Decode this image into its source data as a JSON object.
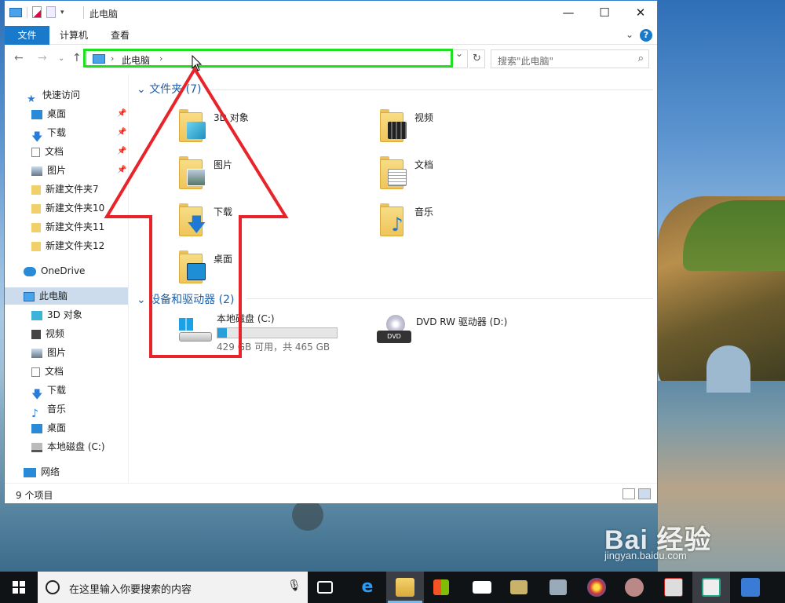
{
  "window": {
    "title": "此电脑",
    "controls": {
      "minimize": "—",
      "maximize": "☐",
      "close": "✕"
    }
  },
  "ribbon": {
    "tabs": [
      "文件",
      "计算机",
      "查看"
    ]
  },
  "address": {
    "crumbs": [
      "此电脑"
    ],
    "search_placeholder": "搜索\"此电脑\""
  },
  "sidebar": {
    "quick_access": "快速访问",
    "quick_items": [
      "桌面",
      "下载",
      "文档",
      "图片",
      "新建文件夹7",
      "新建文件夹10",
      "新建文件夹11",
      "新建文件夹12"
    ],
    "onedrive": "OneDrive",
    "this_pc": "此电脑",
    "pc_items": [
      "3D 对象",
      "视频",
      "图片",
      "文档",
      "下载",
      "音乐",
      "桌面",
      "本地磁盘 (C:)"
    ],
    "network": "网络"
  },
  "main": {
    "folders_header": "文件夹 (7)",
    "folders": [
      "3D 对象",
      "视频",
      "图片",
      "文档",
      "下载",
      "音乐",
      "桌面"
    ],
    "devices_header": "设备和驱动器 (2)",
    "drives": [
      {
        "name": "本地磁盘 (C:)",
        "space": "429 GB 可用，共 465 GB",
        "used_fraction": 0.08
      },
      {
        "name": "DVD RW 驱动器 (D:)"
      }
    ]
  },
  "status": {
    "count": "9 个项目"
  },
  "taskbar": {
    "search_placeholder": "在这里输入你要搜索的内容"
  },
  "watermark": {
    "brand": "Bai 经验",
    "url": "jingyan.baidu.com"
  },
  "colors": {
    "accent": "#1979ca",
    "highlight_box": "#1ee01e",
    "annotation_arrow": "#e8232a"
  }
}
